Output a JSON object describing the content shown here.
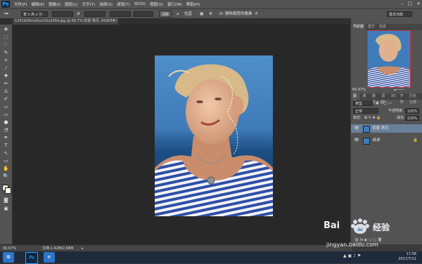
{
  "menubar": {
    "logo": "Ps",
    "items": [
      "文件(F)",
      "编辑(E)",
      "图像(I)",
      "图层(L)",
      "文字(Y)",
      "选择(S)",
      "滤镜(T)",
      "3D(D)",
      "视图(V)",
      "窗口(W)",
      "帮助(H)"
    ]
  },
  "options": {
    "mode": "宽 x 高 x 分",
    "swap_label": "⇄",
    "clear_label": "清除",
    "straighten_label": "拉直",
    "delete_pixels_label": "删除裁剪的像素",
    "workspace": "基本功能"
  },
  "document": {
    "tab_label": "1331426mu5uch2iu200d.jpg @ 66.7%(背景 拷贝, RGB/8#) *",
    "zoom": "66.67%",
    "doc_info": "文档:1.42M/2.84M"
  },
  "panels": {
    "navigator_tabs": [
      "导航器",
      "直方",
      "信息"
    ],
    "nav_zoom": "66.67%",
    "layers_tabs": [
      "图层",
      "通道",
      "路径",
      "调整",
      "3D",
      "字符",
      "历史记录"
    ],
    "kind_filter": "类型",
    "blend_mode": "正常",
    "opacity_label": "不透明度:",
    "opacity_value": "100%",
    "lock_label": "锁定:",
    "fill_label": "填充:",
    "fill_value": "100%",
    "layers": [
      {
        "name": "背景 拷贝",
        "selected": true
      },
      {
        "name": "背景",
        "selected": false
      }
    ]
  },
  "taskbar": {
    "time": "17:58",
    "date": "2017/7/11"
  },
  "watermark": {
    "line1": "Bai",
    "line2": "经验",
    "url": "jingyan.baidu.com"
  }
}
